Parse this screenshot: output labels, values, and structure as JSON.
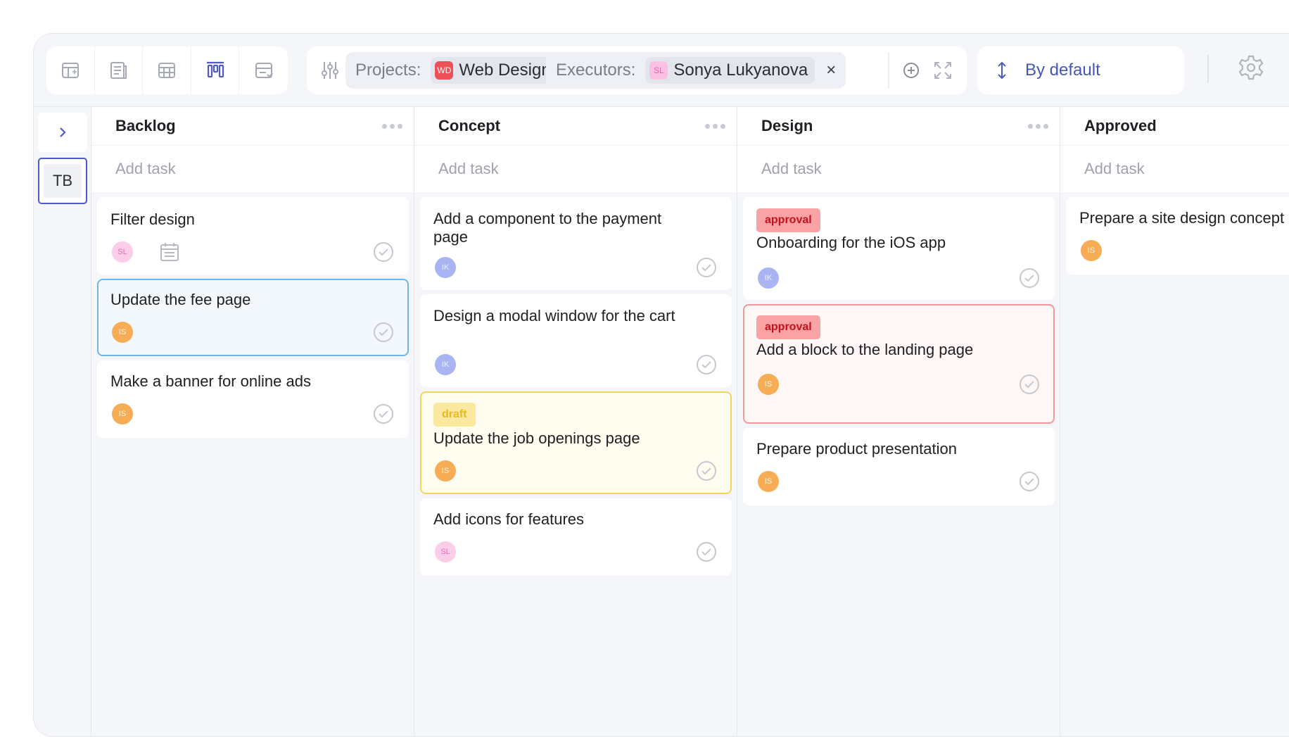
{
  "toolbar": {
    "views": [
      "table-view",
      "list-view",
      "grid-view",
      "board-view",
      "timeline-view"
    ],
    "projects_label": "Projects:",
    "project_badge": "WD",
    "project_name": "Web Design",
    "executors_label": "Executors:",
    "executor_badge": "SL",
    "executor_name": "Sonya Lukyanova",
    "close": "×",
    "sort_label": "By default"
  },
  "rail": {
    "workspace": "TB"
  },
  "columns": [
    {
      "title": "Backlog",
      "add_task": "Add task"
    },
    {
      "title": "Concept",
      "add_task": "Add task"
    },
    {
      "title": "Design",
      "add_task": "Add task"
    },
    {
      "title": "Approved",
      "add_task": "Add task"
    }
  ],
  "cards": {
    "backlog": [
      {
        "title": "Filter design",
        "avatar": "SL"
      },
      {
        "title": "Update the fee page",
        "avatar": "IS"
      },
      {
        "title": "Make a banner for online ads",
        "avatar": "IS"
      }
    ],
    "concept": [
      {
        "title": "Add a component to the payment page",
        "avatar": "IK"
      },
      {
        "title": "Design a modal window for the cart",
        "avatar": "IK"
      },
      {
        "tag": "draft",
        "title": "Update the job openings page",
        "avatar": "IS"
      },
      {
        "title": "Add icons for features",
        "avatar": "SL"
      }
    ],
    "design": [
      {
        "tag": "approval",
        "title": "Onboarding for the iOS app",
        "avatar": "IK"
      },
      {
        "tag": "approval",
        "title": "Add a block to the landing page",
        "avatar": "IS"
      },
      {
        "title": "Prepare product presentation",
        "avatar": "IS"
      }
    ],
    "approved": [
      {
        "title": "Prepare a site design concept",
        "avatar": "IS"
      }
    ]
  },
  "colors": {
    "accent": "#4e59c7",
    "approval_tag": "#f9a3a5",
    "draft_tag": "#fbe9a2",
    "selected_border": "#6eb6e8"
  }
}
